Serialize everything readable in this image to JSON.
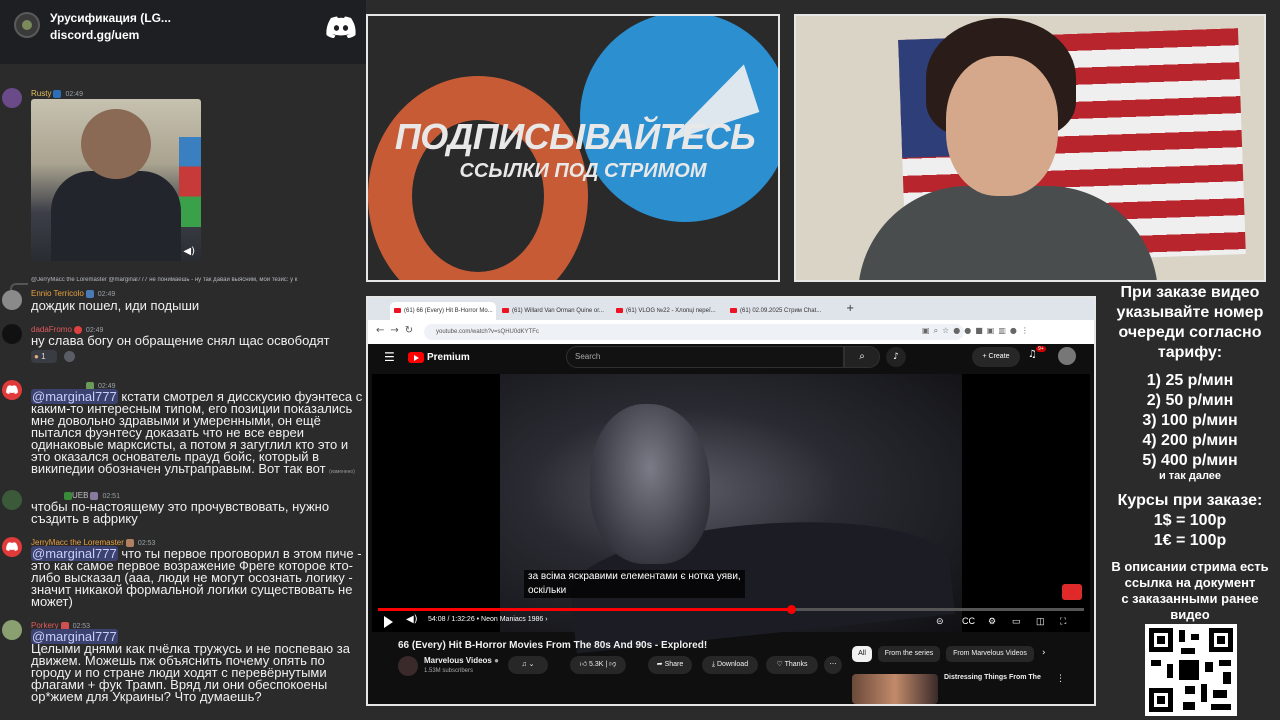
{
  "discord": {
    "server_name": "Урусификация (LG...",
    "invite": "discord.gg/uem"
  },
  "chat": {
    "m1_user": "Rusty",
    "m1_time": "02:49",
    "reply_preview": "@JerryMacc the Loremaster @marginal777 не понимаешь - ну так давай выясним, мой тезис: у к",
    "m2_user": "Ennio Terricolo",
    "m2_time": "02:49",
    "m2_text": "дождик пошел, иди подыши",
    "m3_user": "dadaFromo",
    "m3_time": "02:49",
    "m3_text": "ну слава богу он обращение снял щас освободят",
    "m3_reaction_count": "1",
    "m4_time": "02:49",
    "m4_mention": "@marginal777",
    "m4_text": " кстати смотрел я дисскусию фуэнтеса с каким-то интересным типом, его позиции показались мне довольно здравыми и умеренными, он ещё пытался фуэнтесу доказать что не все евреи одинаковые марксисты, а потом я загуглил кто это и это оказался основатель прауд бойс, который в википедии обозначен ультраправым. Вот так вот",
    "m4_edited": "(изменено)",
    "m5_user": "UEB",
    "m5_time": "02:51",
    "m5_text": "чтобы по-настоящему это прочувствовать, нужно създить в африку",
    "m6_user": "JerryMacc the Loremaster",
    "m6_time": "02:53",
    "m6_mention": "@marginal777",
    "m6_text": " что ты первое проговорил в этом пиче - это как самое первое возражение Фреге которое кто-либо высказал (ааа, люди не могут осознать логику - значит никакой формальной логики существовать не может)",
    "m7_user": "Porkery",
    "m7_time": "02:53",
    "m7_mention": "@marginal777",
    "m7_text": "Целыми днями как пчёлка тружусь и не поспеваю за движем. Можешь пж объяснить почему опять по городу и по стране люди ходят с перевёрнутыми флагами + фук Трамп. Вряд ли они обеспокоены ор*жием для Украины? Что думаешь?"
  },
  "banner": {
    "title": "ПОДПИСЫВАЙТЕСЬ",
    "subtitle": "ССЫЛКИ ПОД СТРИМОМ"
  },
  "browser": {
    "tabs": [
      "(61) 66 (Every) Hit B-Horror Mo...",
      "(61) Willard Van Orman Quine or...",
      "(61) VLOG №22 - Хлопці переї...",
      "(61) 02.09.2025 Стрим Chat..."
    ],
    "url": "youtube.com/watch?v=sQHU0dKYTFc"
  },
  "youtube": {
    "brand": "Premium",
    "search_placeholder": "Search",
    "create_label": "Create",
    "notif_count": "9+",
    "subtitle_line1": "за всіма яскравими елементами є нотка уяви,",
    "subtitle_line2": "оскільки",
    "time": "54:08 / 1:32:26  •  Neon Maniacs 1986  ›",
    "progress": 0.585,
    "video_title": "66 (Every) Hit B-Horror Movies From The 80s And 90s - Explored!",
    "channel_name": "Marvelous Videos",
    "channel_subs": "1.53M subscribers",
    "likes": "5.3K",
    "share_label": "Share",
    "download_label": "Download",
    "thanks_label": "Thanks",
    "chips": [
      "All",
      "From the series",
      "From Marvelous Videos"
    ],
    "rec_title": "Distressing Things From The"
  },
  "info": {
    "l1": "При заказе видео",
    "l2": "указывайте номер",
    "l3": "очереди согласно",
    "l4": "тарифу:",
    "p1": "1) 25 р/мин",
    "p2": "2) 50 р/мин",
    "p3": "3) 100 р/мин",
    "p4": "4) 200 р/мин",
    "p5": "5) 400 р/мин",
    "etc": "и так далее",
    "courses_title": "Курсы при заказе:",
    "c1": "1$ = 100р",
    "c2": "1€ = 100р",
    "d1": "В описании стрима есть",
    "d2": "ссылка на документ",
    "d3": "с заказанными ранее",
    "d4": "видео"
  },
  "colors": {
    "discord_blurple": "#5865f2",
    "youtube_red": "#ff0000",
    "mention_bg": "#3c4270"
  }
}
